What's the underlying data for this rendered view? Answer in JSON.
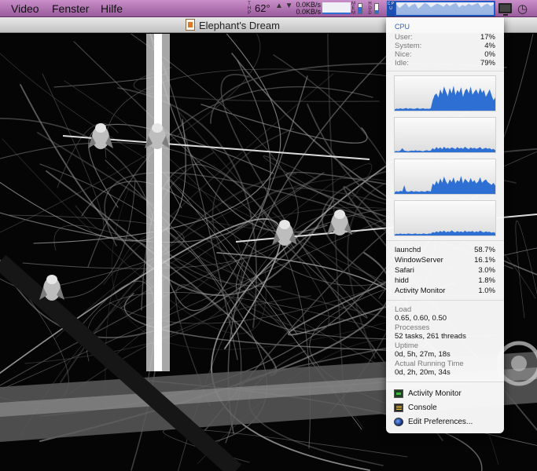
{
  "menubar": {
    "items": [
      "Video",
      "Fenster",
      "Hilfe"
    ],
    "temp_label": "T H P",
    "temperature": "62°",
    "net_updown": "▲ ▼",
    "net_up": "0.0KB/s",
    "net_down": "0.0KB/s",
    "mem_label": "M E M",
    "disk_label": "H D D",
    "cpu_label": "C P U",
    "cpu_graph": [
      0.85,
      0.55,
      0.75,
      0.95,
      0.6,
      0.8,
      0.9,
      0.5,
      0.7,
      0.95,
      0.85,
      0.6,
      0.75,
      0.9,
      0.8,
      0.65,
      0.9,
      0.7,
      0.85,
      0.95,
      0.6,
      0.8,
      0.7,
      0.9,
      0.75,
      0.85,
      0.95,
      0.6,
      0.8,
      0.9,
      0.7,
      0.85
    ]
  },
  "window": {
    "title": "Elephant's Dream"
  },
  "cpu_panel": {
    "title": "CPU",
    "rows": [
      {
        "label": "User:",
        "value": "17%"
      },
      {
        "label": "System:",
        "value": "4%"
      },
      {
        "label": "Nice:",
        "value": "0%"
      },
      {
        "label": "Idle:",
        "value": "79%"
      }
    ],
    "histories": [
      [
        0.04,
        0.06,
        0.05,
        0.07,
        0.05,
        0.06,
        0.08,
        0.05,
        0.07,
        0.06,
        0.05,
        0.06,
        0.08,
        0.05,
        0.06,
        0.07,
        0.05,
        0.06,
        0.05,
        0.07,
        0.3,
        0.45,
        0.5,
        0.38,
        0.62,
        0.48,
        0.7,
        0.55,
        0.42,
        0.66,
        0.5,
        0.72,
        0.45,
        0.6,
        0.52,
        0.68,
        0.4,
        0.58,
        0.64,
        0.5,
        0.7,
        0.46,
        0.55,
        0.62,
        0.48,
        0.66,
        0.52,
        0.6,
        0.4,
        0.5,
        0.62,
        0.45,
        0.3,
        0.38
      ],
      [
        0.03,
        0.04,
        0.03,
        0.05,
        0.12,
        0.05,
        0.04,
        0.03,
        0.04,
        0.05,
        0.04,
        0.06,
        0.04,
        0.05,
        0.04,
        0.03,
        0.05,
        0.06,
        0.04,
        0.05,
        0.12,
        0.08,
        0.15,
        0.1,
        0.14,
        0.09,
        0.16,
        0.11,
        0.13,
        0.1,
        0.14,
        0.12,
        0.09,
        0.15,
        0.11,
        0.13,
        0.1,
        0.16,
        0.12,
        0.09,
        0.14,
        0.11,
        0.13,
        0.1,
        0.12,
        0.15,
        0.09,
        0.11,
        0.13,
        0.1,
        0.12,
        0.08,
        0.1,
        0.06
      ],
      [
        0.05,
        0.08,
        0.06,
        0.09,
        0.07,
        0.25,
        0.08,
        0.06,
        0.07,
        0.09,
        0.06,
        0.08,
        0.07,
        0.06,
        0.08,
        0.07,
        0.06,
        0.09,
        0.08,
        0.07,
        0.3,
        0.25,
        0.38,
        0.28,
        0.45,
        0.32,
        0.5,
        0.36,
        0.28,
        0.42,
        0.34,
        0.48,
        0.3,
        0.4,
        0.35,
        0.52,
        0.3,
        0.44,
        0.38,
        0.32,
        0.46,
        0.34,
        0.4,
        0.3,
        0.36,
        0.48,
        0.32,
        0.38,
        0.42,
        0.34,
        0.3,
        0.26,
        0.32,
        0.24
      ],
      [
        0.03,
        0.05,
        0.04,
        0.06,
        0.04,
        0.05,
        0.04,
        0.06,
        0.05,
        0.04,
        0.05,
        0.06,
        0.04,
        0.05,
        0.04,
        0.06,
        0.05,
        0.04,
        0.06,
        0.05,
        0.1,
        0.08,
        0.12,
        0.09,
        0.13,
        0.1,
        0.14,
        0.09,
        0.12,
        0.1,
        0.15,
        0.11,
        0.09,
        0.13,
        0.1,
        0.12,
        0.09,
        0.14,
        0.1,
        0.12,
        0.11,
        0.13,
        0.09,
        0.12,
        0.1,
        0.14,
        0.11,
        0.09,
        0.12,
        0.1,
        0.11,
        0.08,
        0.1,
        0.07
      ]
    ],
    "processes": [
      {
        "name": "launchd",
        "value": "58.7%"
      },
      {
        "name": "WindowServer",
        "value": "16.1%"
      },
      {
        "name": "Safari",
        "value": "3.0%"
      },
      {
        "name": "hidd",
        "value": "1.8%"
      },
      {
        "name": "Activity Monitor",
        "value": "1.0%"
      }
    ],
    "stats": [
      {
        "label": "Load",
        "value": "0.65, 0.60, 0.50"
      },
      {
        "label": "Processes",
        "value": "52 tasks, 261 threads"
      },
      {
        "label": "Uptime",
        "value": "0d, 5h, 27m, 18s"
      },
      {
        "label": "Actual Running Time",
        "value": "0d, 2h, 20m, 34s"
      }
    ],
    "actions": [
      "Activity Monitor",
      "Console",
      "Edit Preferences..."
    ]
  },
  "colors": {
    "graph_blue": "#2e6fd4",
    "section_title": "#1e64c8",
    "menubar": "#b577b7"
  }
}
